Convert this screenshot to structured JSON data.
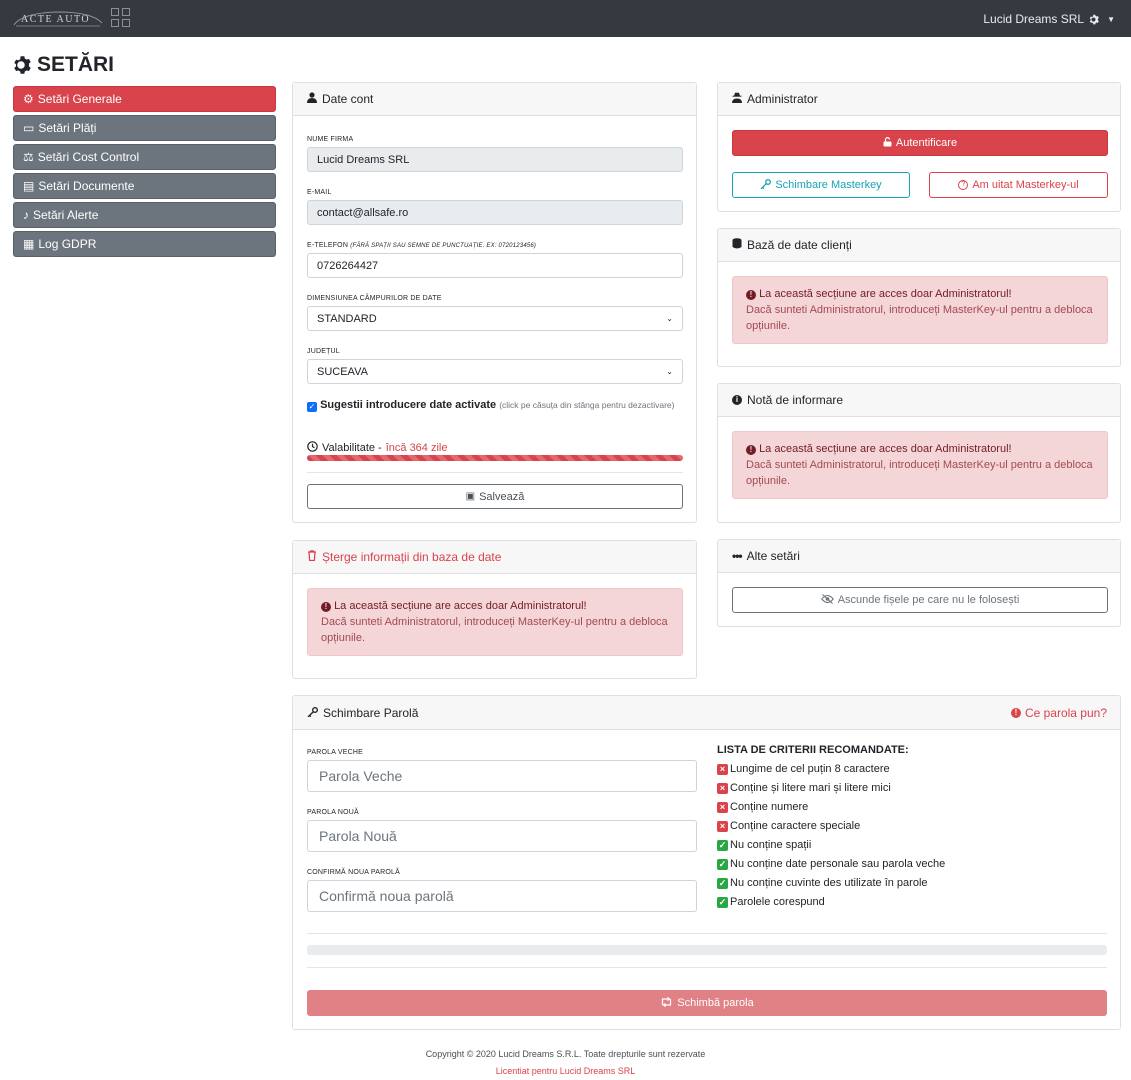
{
  "topbar": {
    "logo": "ACTE AUTO",
    "company": "Lucid Dreams SRL"
  },
  "page": {
    "title": "SETĂRI"
  },
  "sidebar": {
    "items": [
      {
        "label": "Setări Generale"
      },
      {
        "label": "Setări Plăți"
      },
      {
        "label": "Setări Cost Control"
      },
      {
        "label": "Setări Documente"
      },
      {
        "label": "Setări Alerte"
      },
      {
        "label": "Log GDPR"
      }
    ]
  },
  "account": {
    "header": "Date cont",
    "company_label": "NUME FIRMA",
    "company_value": "Lucid Dreams SRL",
    "email_label": "E-MAIL",
    "email_value": "contact@allsafe.ro",
    "phone_label": "E-TELEFON",
    "phone_hint": "(FĂRĂ SPAȚII SAU SEMNE DE PUNCTUAȚIE. EX: 0720123456)",
    "phone_value": "0726264427",
    "size_label": "DIMENSIUNEA CÂMPURILOR DE DATE",
    "size_value": "STANDARD",
    "county_label": "JUDEȚUL",
    "county_value": "SUCEAVA",
    "suggest_label": "Sugestii introducere date activate",
    "suggest_hint": "(click pe căsuța din stânga pentru dezactivare)",
    "validity_label": "Valabilitate -",
    "validity_value": "încă 364 zile",
    "validity_progress": 1.0,
    "save_label": "Salvează"
  },
  "delete_info": {
    "header": "Șterge informații din baza de date",
    "alert_title": "La această secțiune are acces doar Administratorul!",
    "alert_body": "Dacă sunteti Administratorul, introduceți MasterKey-ul pentru a debloca opțiunile."
  },
  "admin": {
    "header": "Administrator",
    "login_label": "Autentificare",
    "change_label": "Schimbare Masterkey",
    "forgot_label": "Am uitat Masterkey-ul"
  },
  "clients_db": {
    "header": "Bază de date clienți",
    "alert_title": "La această secțiune are acces doar Administratorul!",
    "alert_body": "Dacă sunteti Administratorul, introduceți MasterKey-ul pentru a debloca opțiunile."
  },
  "info_note": {
    "header": "Notă de informare",
    "alert_title": "La această secțiune are acces doar Administratorul!",
    "alert_body": "Dacă sunteti Administratorul, introduceți MasterKey-ul pentru a debloca opțiunile."
  },
  "other_settings": {
    "header": "Alte setări",
    "hide_label": "Ascunde fișele pe care nu le folosești"
  },
  "password": {
    "header": "Schimbare Parolă",
    "help_label": "Ce parola pun?",
    "old_label": "PAROLA VECHE",
    "old_placeholder": "Parola Veche",
    "new_label": "PAROLA NOUĂ",
    "new_placeholder": "Parola Nouă",
    "confirm_label": "CONFIRMĂ NOUA PAROLĂ",
    "confirm_placeholder": "Confirmă noua parolă",
    "criteria_title": "LISTA DE CRITERII RECOMANDATE:",
    "criteria": [
      {
        "text": "Lungime de cel puțin 8 caractere",
        "ok": false
      },
      {
        "text": "Conține și litere mari și litere mici",
        "ok": false
      },
      {
        "text": "Conține numere",
        "ok": false
      },
      {
        "text": "Conține caractere speciale",
        "ok": false
      },
      {
        "text": "Nu conține spații",
        "ok": true
      },
      {
        "text": "Nu conține date personale sau parola veche",
        "ok": true
      },
      {
        "text": "Nu conține cuvinte des utilizate în parole",
        "ok": true
      },
      {
        "text": "Parolele corespund",
        "ok": true
      }
    ],
    "strength_progress": 0,
    "submit_label": "Schimbă parola"
  },
  "footer": {
    "copyright": "Copyright © 2020 Lucid Dreams S.R.L. Toate drepturile sunt rezervate",
    "license": "Licentiat pentru Lucid Dreams SRL"
  },
  "colors": {
    "accent": "#d9434b",
    "topbar": "#343a40",
    "sidebar": "#6c757d",
    "success": "#28a745",
    "info": "#17a2b8"
  }
}
